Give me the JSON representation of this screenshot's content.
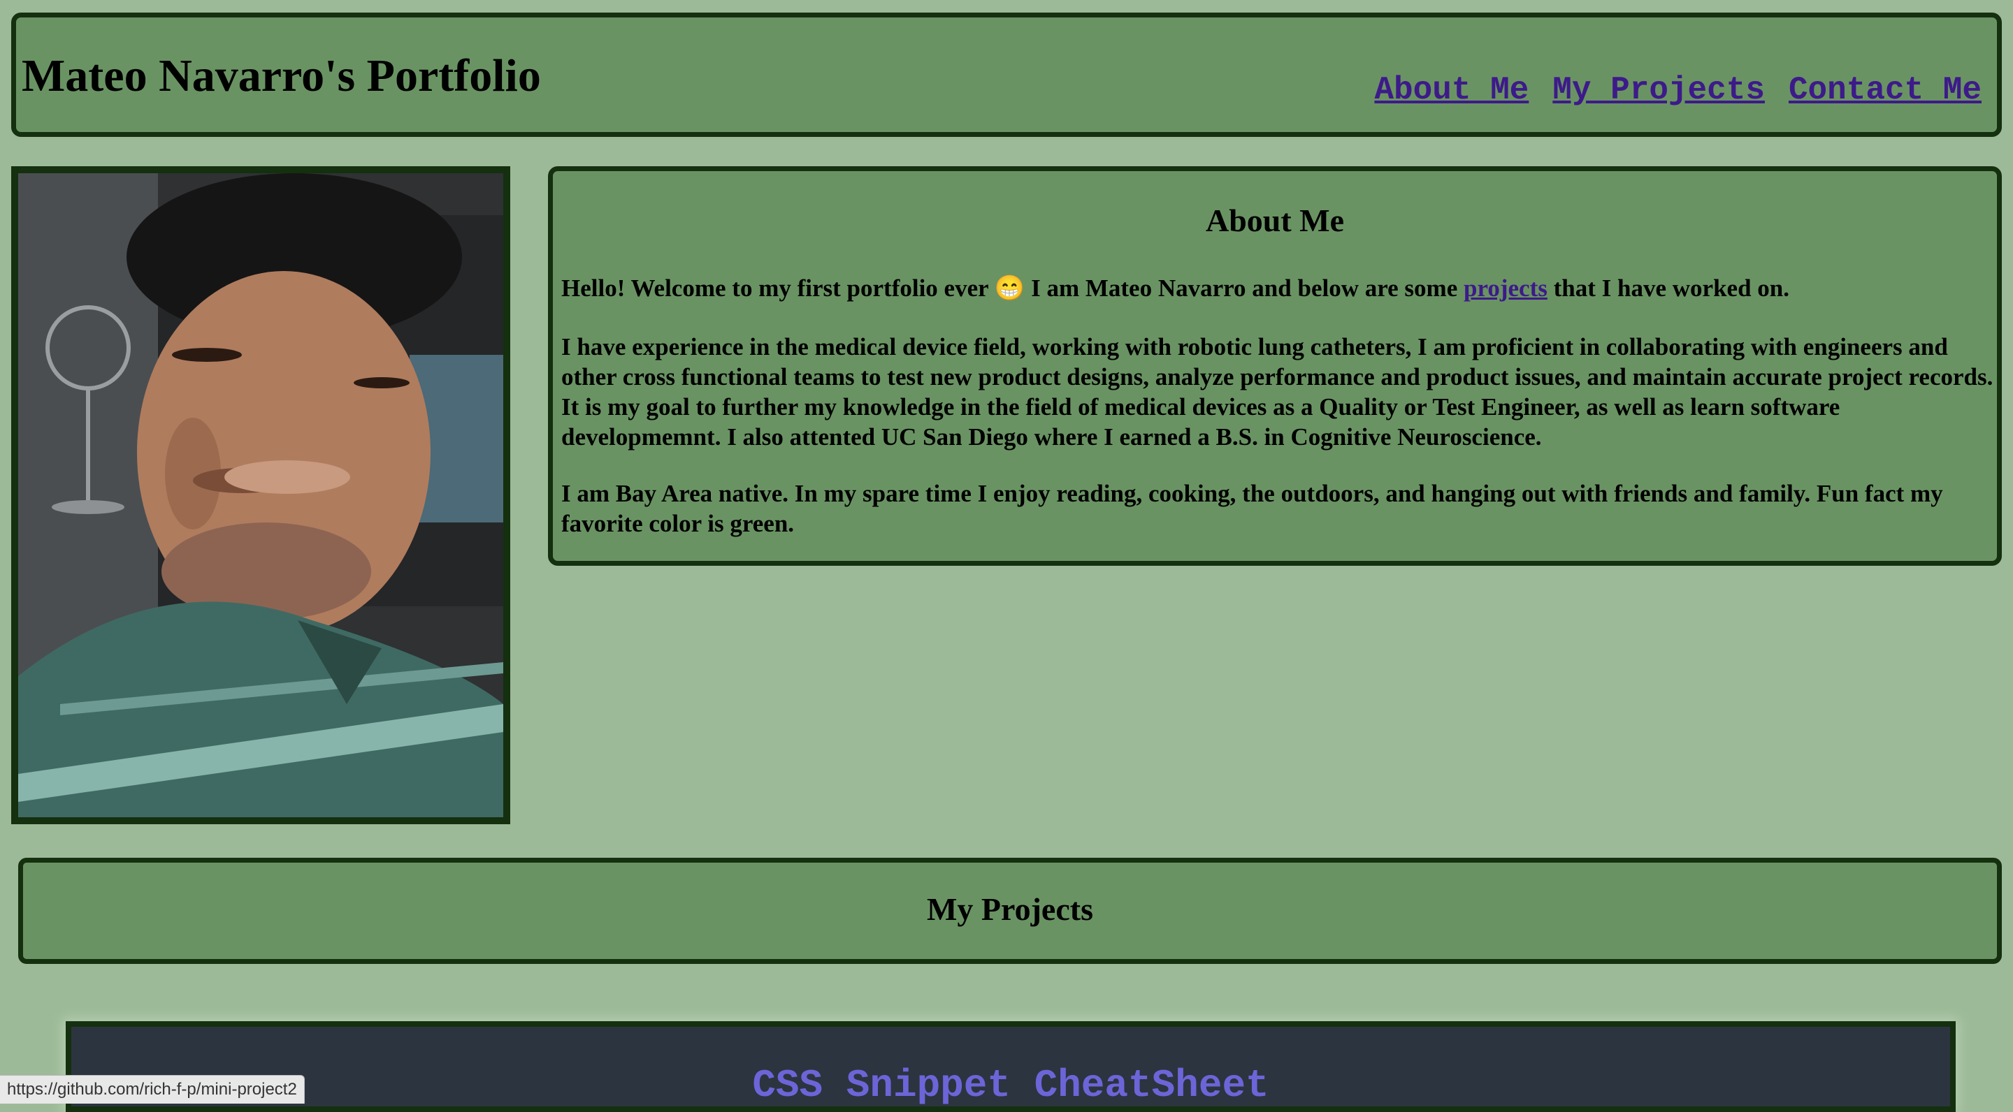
{
  "header": {
    "title": "Mateo Navarro's Portfolio",
    "nav": [
      {
        "label": "About Me"
      },
      {
        "label": "My Projects"
      },
      {
        "label": "Contact Me"
      }
    ]
  },
  "about": {
    "heading": "About Me",
    "p1_before": "Hello! Welcome to my first portfolio ever 😁 I am Mateo Navarro and below are some ",
    "p1_link": "projects",
    "p1_after": " that I have worked on.",
    "p2": "I have experience in the medical device field, working with robotic lung catheters, I am proficient in collaborating with engineers and other cross functional teams to test new product designs, analyze performance and product issues, and maintain accurate project records. It is my goal to further my knowledge in the field of medical devices as a Quality or Test Engineer, as well as learn software developmemnt. I also attented UC San Diego where I earned a B.S. in Cognitive Neuroscience.",
    "p3": "I am Bay Area native. In my spare time I enjoy reading, cooking, the outdoors, and hanging out with friends and family. Fun fact my favorite color is green."
  },
  "projects": {
    "heading": "My Projects",
    "cards": [
      {
        "title": "CSS Snippet CheatSheet"
      }
    ]
  },
  "status_bar": {
    "url": "https://github.com/rich-f-p/mini-project2"
  },
  "colors": {
    "page_bg": "#9dba98",
    "box_bg": "#6a9363",
    "border": "#14300f",
    "link": "#3d1a8a",
    "card_bg": "#2c3440",
    "card_title": "#6c65d8"
  }
}
